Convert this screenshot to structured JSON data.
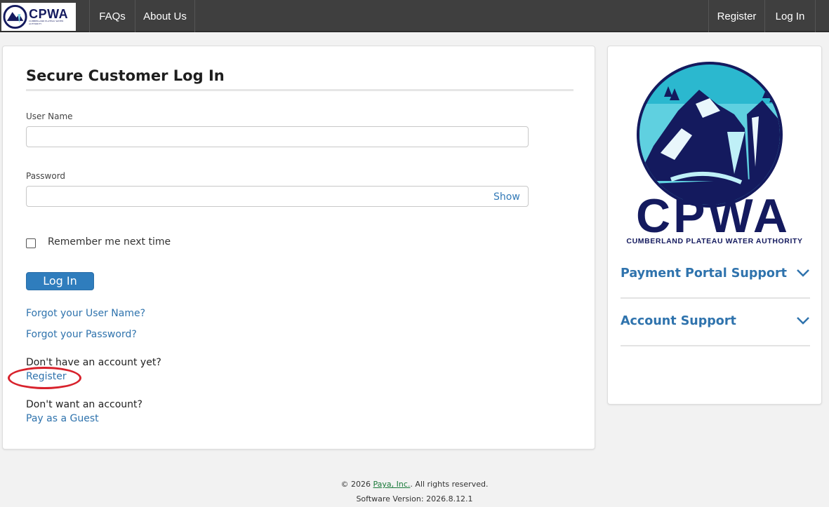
{
  "nav": {
    "logo_text": "CPWA",
    "logo_subtext": "CUMBERLAND PLATEAU WATER AUTHORITY",
    "faqs": "FAQs",
    "about": "About Us",
    "register": "Register",
    "login": "Log In"
  },
  "login": {
    "title": "Secure Customer Log In",
    "username_label": "User Name",
    "username_value": "",
    "password_label": "Password",
    "password_value": "",
    "show_label": "Show",
    "remember_label": "Remember me next time",
    "remember_checked": false,
    "login_button": "Log In",
    "forgot_username": "Forgot your User Name?",
    "forgot_password": "Forgot your Password?",
    "no_account_text": "Don't have an account yet?",
    "register_link": "Register",
    "no_want_text": "Don't want an account?",
    "guest_link": "Pay as a Guest"
  },
  "sidebar": {
    "logo_word": "CPWA",
    "logo_sub": "CUMBERLAND PLATEAU WATER AUTHORITY",
    "accordion": [
      {
        "label": "Payment Portal Support"
      },
      {
        "label": "Account Support"
      }
    ]
  },
  "footer": {
    "copyright_prefix": "© 2026 ",
    "company_link": "Paya, Inc.",
    "copyright_suffix": ". All rights reserved.",
    "version": "Software Version: 2026.8.12.1"
  },
  "colors": {
    "nav_bg": "#3f3f3f",
    "accent": "#2f73ad",
    "button": "#2f7dbd",
    "brand_navy": "#141a5e",
    "annotation": "#d8222c"
  }
}
